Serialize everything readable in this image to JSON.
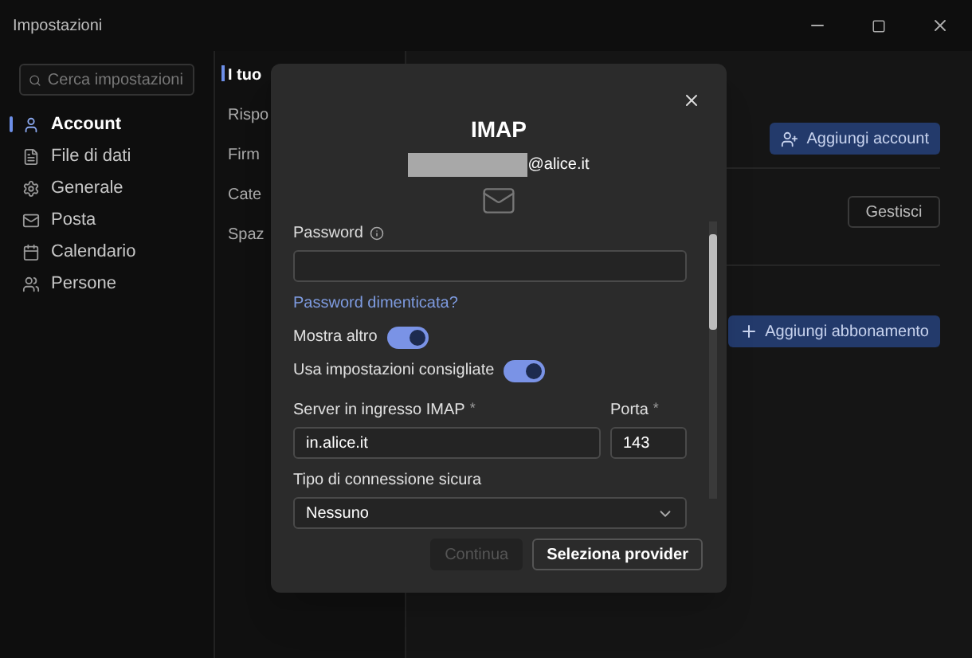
{
  "window": {
    "title": "Impostazioni"
  },
  "search": {
    "placeholder": "Cerca impostazioni"
  },
  "sidebar": {
    "items": [
      {
        "label": "Account",
        "selected": true
      },
      {
        "label": "File di dati",
        "selected": false
      },
      {
        "label": "Generale",
        "selected": false
      },
      {
        "label": "Posta",
        "selected": false
      },
      {
        "label": "Calendario",
        "selected": false
      },
      {
        "label": "Persone",
        "selected": false
      }
    ]
  },
  "subnav": {
    "items": [
      {
        "label": "I tuo",
        "selected": true
      },
      {
        "label": "Rispo",
        "selected": false
      },
      {
        "label": "Firm",
        "selected": false
      },
      {
        "label": "Cate",
        "selected": false
      },
      {
        "label": "Spaz",
        "selected": false
      }
    ]
  },
  "main": {
    "add_account": "Aggiungi account",
    "manage": "Gestisci",
    "add_subscription": "Aggiungi abbonamento"
  },
  "dialog": {
    "title": "IMAP",
    "email_suffix": "@alice.it",
    "password": {
      "label": "Password"
    },
    "forgot_link": "Password dimenticata?",
    "toggles": [
      {
        "label": "Mostra altro",
        "on": true
      },
      {
        "label": "Usa impostazioni consigliate",
        "on": true
      }
    ],
    "server": {
      "label": "Server in ingresso IMAP",
      "mark": "*",
      "value": "in.alice.it"
    },
    "port": {
      "label": "Porta",
      "mark": "*",
      "value": "143"
    },
    "security": {
      "label": "Tipo di connessione sicura",
      "value": "Nessuno"
    },
    "buttons": [
      {
        "label": "Continua",
        "disabled": true
      },
      {
        "label": "Seleziona provider",
        "disabled": false
      }
    ]
  }
}
